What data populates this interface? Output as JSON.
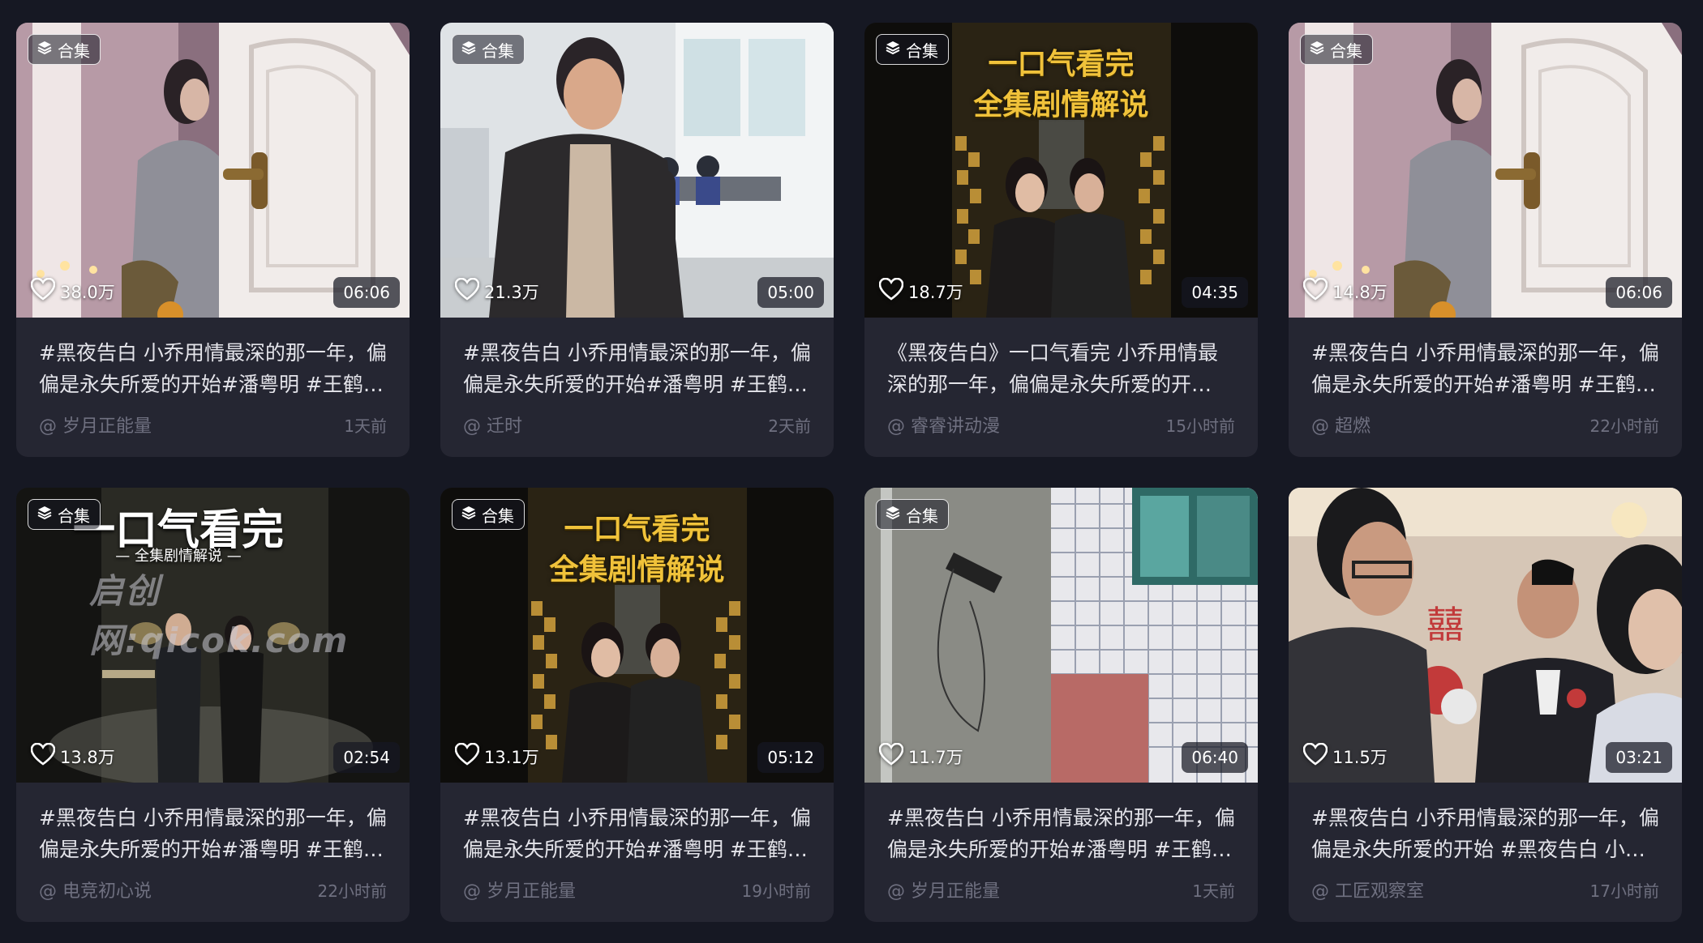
{
  "badge_label": "合集",
  "cards": [
    {
      "likes": "38.0万",
      "duration": "06:06",
      "title": "#黑夜告白 小乔用情最深的那一年，偏偏是永失所爱的开始#潘粤明 #王鹤…",
      "author": "@ 岁月正能量",
      "time": "1天前",
      "has_badge": true,
      "scene": "door"
    },
    {
      "likes": "21.3万",
      "duration": "05:00",
      "title": "#黑夜告白 小乔用情最深的那一年，偏偏是永失所爱的开始#潘粤明 #王鹤…",
      "author": "@ 迁时",
      "time": "2天前",
      "has_badge": true,
      "scene": "classroom"
    },
    {
      "likes": "18.7万",
      "duration": "04:35",
      "title": "《黑夜告白》一口气看完 小乔用情最深的那一年，偏偏是永失所爱的开…",
      "author": "@ 睿睿讲动漫",
      "time": "15小时前",
      "has_badge": true,
      "scene": "poster-gold",
      "poster_line1": "一口气看完",
      "poster_line2": "全集剧情解说"
    },
    {
      "likes": "14.8万",
      "duration": "06:06",
      "title": "#黑夜告白 小乔用情最深的那一年，偏偏是永失所爱的开始#潘粤明 #王鹤…",
      "author": "@ 超燃",
      "time": "22小时前",
      "has_badge": true,
      "scene": "door"
    },
    {
      "likes": "13.8万",
      "duration": "02:54",
      "title": "#黑夜告白 小乔用情最深的那一年，偏偏是永失所爱的开始#潘粤明 #王鹤…",
      "author": "@ 电竞初心说",
      "time": "22小时前",
      "has_badge": true,
      "scene": "poster-dark",
      "poster_line1": "一口气看完",
      "poster_line2": "— 全集剧情解说 —",
      "watermark": "启创网:qicok.com"
    },
    {
      "likes": "13.1万",
      "duration": "05:12",
      "title": "#黑夜告白 小乔用情最深的那一年，偏偏是永失所爱的开始#潘粤明 #王鹤…",
      "author": "@ 岁月正能量",
      "time": "19小时前",
      "has_badge": true,
      "scene": "poster-gold",
      "poster_line1": "一口气看完",
      "poster_line2": "全集剧情解说"
    },
    {
      "likes": "11.7万",
      "duration": "06:40",
      "title": "#黑夜告白 小乔用情最深的那一年，偏偏是永失所爱的开始#潘粤明 #王鹤…",
      "author": "@ 岁月正能量",
      "time": "1天前",
      "has_badge": true,
      "scene": "building"
    },
    {
      "likes": "11.5万",
      "duration": "03:21",
      "title": "#黑夜告白 小乔用情最深的那一年，偏偏是永失所爱的开始 #黑夜告白 小…",
      "author": "@ 工匠观察室",
      "time": "17小时前",
      "has_badge": false,
      "scene": "wedding"
    }
  ],
  "colors": {
    "background": "#161823",
    "card": "#252632",
    "poster_gold": "#f0c23a"
  }
}
